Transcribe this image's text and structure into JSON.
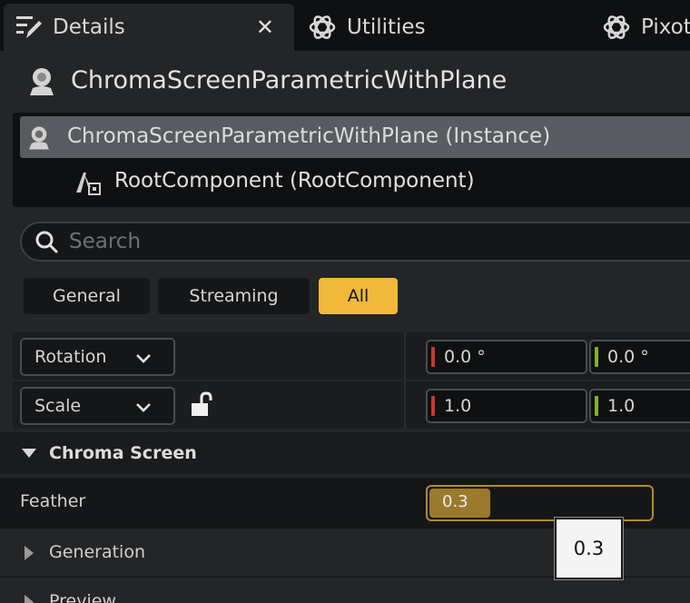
{
  "tabs": [
    {
      "label": "Details",
      "icon": "pencil-details-icon",
      "active": true
    },
    {
      "label": "Utilities",
      "icon": "utilities-icon",
      "active": false
    },
    {
      "label": "Pixot",
      "icon": "utilities-icon",
      "active": false
    }
  ],
  "actor": {
    "name": "ChromaScreenParametricWithPlane",
    "icon": "actor-icon"
  },
  "components": {
    "selected": "ChromaScreenParametricWithPlane (Instance)",
    "child": "RootComponent (RootComponent)"
  },
  "search": {
    "placeholder": "Search",
    "value": ""
  },
  "filters": [
    "General",
    "Streaming",
    "All"
  ],
  "active_filter": "All",
  "transform": {
    "rotation": {
      "label": "Rotation",
      "x": "0.0 °",
      "y": "0.0 °"
    },
    "scale": {
      "label": "Scale",
      "x": "1.0",
      "y": "1.0",
      "locked": false
    }
  },
  "sections": {
    "chroma_screen": "Chroma Screen",
    "generation": "Generation",
    "preview": "Preview"
  },
  "feather": {
    "label": "Feather",
    "value": "0.3",
    "fraction": 0.3
  },
  "tooltip": {
    "text": "0.3"
  },
  "colors": {
    "accent": "#f1b93a",
    "axis_x": "#c8372a",
    "axis_y": "#7fb32a",
    "slider_fill": "#9b7a2e",
    "panel_bg": "#242527"
  }
}
